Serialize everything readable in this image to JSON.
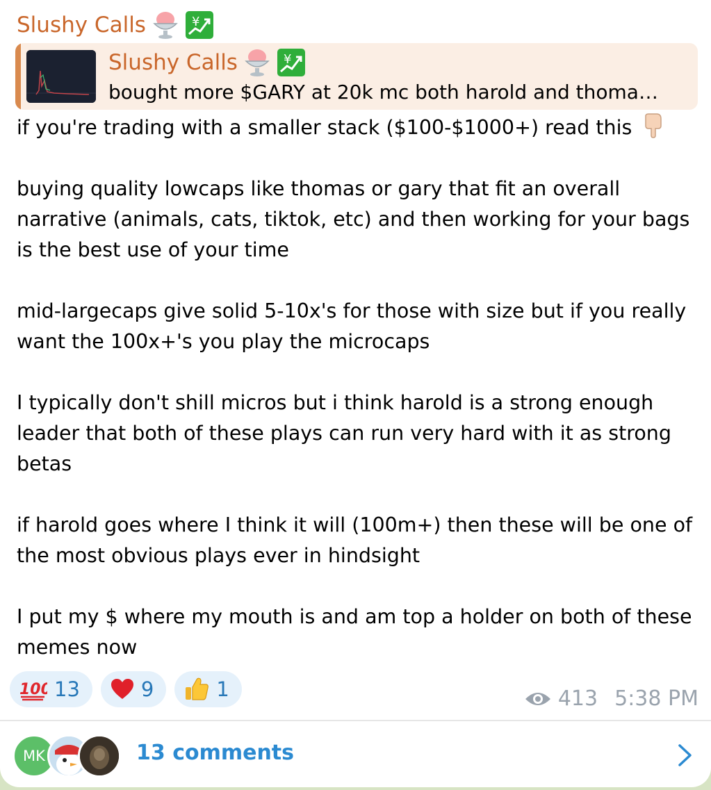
{
  "channel": {
    "name": "Slushy Calls"
  },
  "reply": {
    "name": "Slushy Calls",
    "text": "bought more $GARY at 20k mc  both harold and thoma…"
  },
  "message": {
    "paragraphs": [
      "if you're trading with a smaller stack ($100-$1000+) read this",
      "buying quality lowcaps like thomas or gary that fit an overall narrative (animals, cats, tiktok, etc) and then working for your bags is the best use of your time",
      "mid-largecaps give solid 5-10x's for those with size but if you really want the 100x+'s you play the microcaps",
      "I typically don't shill micros but i think harold is a strong enough leader that both of these plays can run very hard with it as strong betas",
      "if harold goes where I think it will (100m+) then these will be one of the most obvious plays ever in hindsight",
      "I put my $ where my mouth is and am top a holder on both of these memes now"
    ]
  },
  "reactions": [
    {
      "icon": "hundred-points-icon",
      "count": "13"
    },
    {
      "icon": "red-heart-icon",
      "count": "9"
    },
    {
      "icon": "thumbs-up-icon",
      "count": "1"
    }
  ],
  "meta": {
    "views": "413",
    "time": "5:38 PM"
  },
  "comments": {
    "avatar_initials": "MK",
    "label": "13 comments"
  },
  "colors": {
    "sender_name": "#c9662a",
    "link_blue": "#2b8ad1",
    "reply_bg": "#fbeee4",
    "reply_bar": "#d98a4e",
    "reaction_bg": "#e5f1fb"
  }
}
